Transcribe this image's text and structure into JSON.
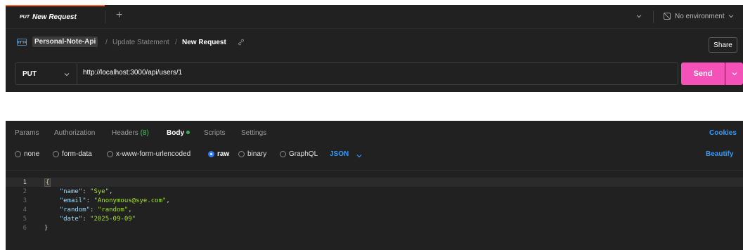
{
  "tab": {
    "method": "PUT",
    "title": "New Request",
    "add_label": "+"
  },
  "environment": {
    "label": "No environment"
  },
  "breadcrumb": {
    "collection": "Personal-Note-Api",
    "folder": "Update Statement",
    "request": "New Request",
    "separator": "/"
  },
  "share_label": "Share",
  "request": {
    "method": "PUT",
    "url": "http://localhost:3000/api/users/1",
    "send_label": "Send"
  },
  "req_tabs": {
    "params": "Params",
    "authorization": "Authorization",
    "headers": "Headers",
    "headers_count": "(8)",
    "body": "Body",
    "scripts": "Scripts",
    "settings": "Settings",
    "cookies": "Cookies"
  },
  "body_modes": {
    "none": "none",
    "form_data": "form-data",
    "urlencoded": "x-www-form-urlencoded",
    "raw": "raw",
    "binary": "binary",
    "graphql": "GraphQL",
    "selected": "raw",
    "content_type": "JSON",
    "beautify": "Beautify"
  },
  "editor": {
    "line_numbers": [
      "1",
      "2",
      "3",
      "4",
      "5",
      "6"
    ],
    "open_brace": "{",
    "close_brace": "}",
    "fields": [
      {
        "key": "\"name\"",
        "value": "\"Sye\"",
        "trail": ","
      },
      {
        "key": "\"email\"",
        "value": "\"Anonymous@sye.com\"",
        "trail": ","
      },
      {
        "key": "\"random\"",
        "value": "\"random\"",
        "trail": ","
      },
      {
        "key": "\"date\"",
        "value": "\"2025-09-09\"",
        "trail": ""
      }
    ]
  },
  "colors": {
    "send": "#f552b9",
    "accent_blue": "#2e9bff",
    "tab_indicator": "#f26b3a",
    "body_dot": "#36b34f"
  },
  "icons": {
    "environment": "no-environment-icon",
    "collection": "http-collection-icon",
    "link": "link-icon",
    "chevron": "chevron-down-icon"
  }
}
